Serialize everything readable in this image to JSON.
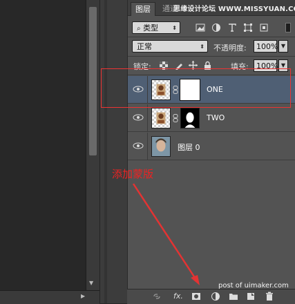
{
  "tabs": [
    {
      "label": "图层"
    },
    {
      "label": "通道"
    }
  ],
  "watermark": "思缘设计论坛  WWW.MISSYUAN.COM",
  "filter": {
    "kind_label": "类型",
    "kind_icon": "search-icon",
    "icons": [
      "image-filter-icon",
      "adjustment-filter-icon",
      "text-filter-icon",
      "shape-filter-icon",
      "smart-object-filter-icon"
    ]
  },
  "blend": {
    "mode": "正常",
    "opacity_label": "不透明度:",
    "opacity_value": "100%"
  },
  "lock": {
    "label": "锁定:",
    "fill_label": "填充:",
    "fill_value": "100%"
  },
  "layers": [
    {
      "name": "ONE",
      "selected": true,
      "visible": true,
      "mask": "white"
    },
    {
      "name": "TWO",
      "selected": false,
      "visible": true,
      "mask": "black-silhouette"
    },
    {
      "name": "图层 0",
      "selected": false,
      "visible": true,
      "mask": null
    }
  ],
  "annotation": "添加蒙版",
  "credit": "post of uimaker.com",
  "bottom_icons": [
    "link-layers-icon",
    "fx-icon",
    "add-mask-icon",
    "adjustment-layer-icon",
    "group-folder-icon",
    "new-layer-icon",
    "trash-icon"
  ],
  "colors": {
    "panel_bg": "#535353",
    "selected_layer": "#4f5f74",
    "highlight_red": "#e33333",
    "canvas_bg": "#282828"
  }
}
